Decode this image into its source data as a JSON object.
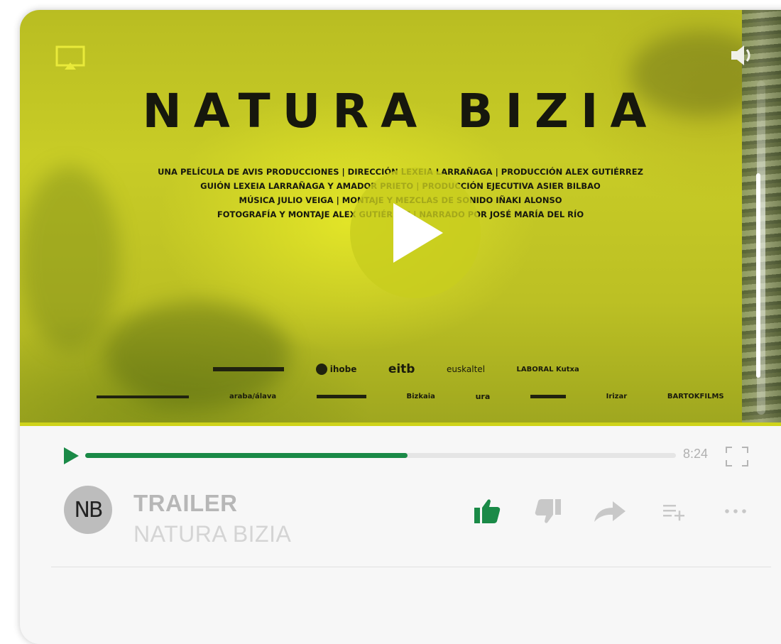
{
  "poster": {
    "title": "NATURA BIZIA",
    "credits": [
      "UNA PELÍCULA DE AVIS PRODUCCIONES | DIRECCIÓN LEXEIA LARRAÑAGA | PRODUCCIÓN ALEX GUTIÉRREZ",
      "GUIÓN LEXEIA LARRAÑAGA Y AMADOR PRIETO | PRODUCCIÓN EJECUTIVA ASIER BILBAO",
      "MÚSICA JULIO VEIGA | MONTAJE Y MEZCLAS DE SONIDO IÑAKI ALONSO",
      "FOTOGRAFÍA Y MONTAJE ALEX GUTIÉRREZ | NARRADO POR JOSÉ MARÍA DEL RÍO"
    ],
    "sponsors_row1": [
      "ihobe",
      "eitb",
      "euskaltel",
      "LABORAL Kutxa"
    ],
    "sponsors_row2": [
      "araba/álava",
      "Bizkaia",
      "ura",
      "Irizar",
      "BARTOKFILMS"
    ]
  },
  "player": {
    "duration": "8:24",
    "progress_fraction": 0.546
  },
  "info": {
    "avatar_initials": "NB",
    "label": "TRAILER",
    "title": "NATURA BIZIA"
  },
  "colors": {
    "accent": "#1a8a47",
    "muted_text": "#b7b7b7",
    "poster_yellow": "#c8cc26"
  },
  "icons": {
    "airplay": "airplay-icon",
    "volume": "volume-icon",
    "play": "play-icon",
    "fullscreen": "fullscreen-icon",
    "like": "thumbs-up-icon",
    "dislike": "thumbs-down-icon",
    "share": "share-arrow-icon",
    "add_to_queue": "add-to-queue-icon",
    "more": "more-dots-icon"
  }
}
